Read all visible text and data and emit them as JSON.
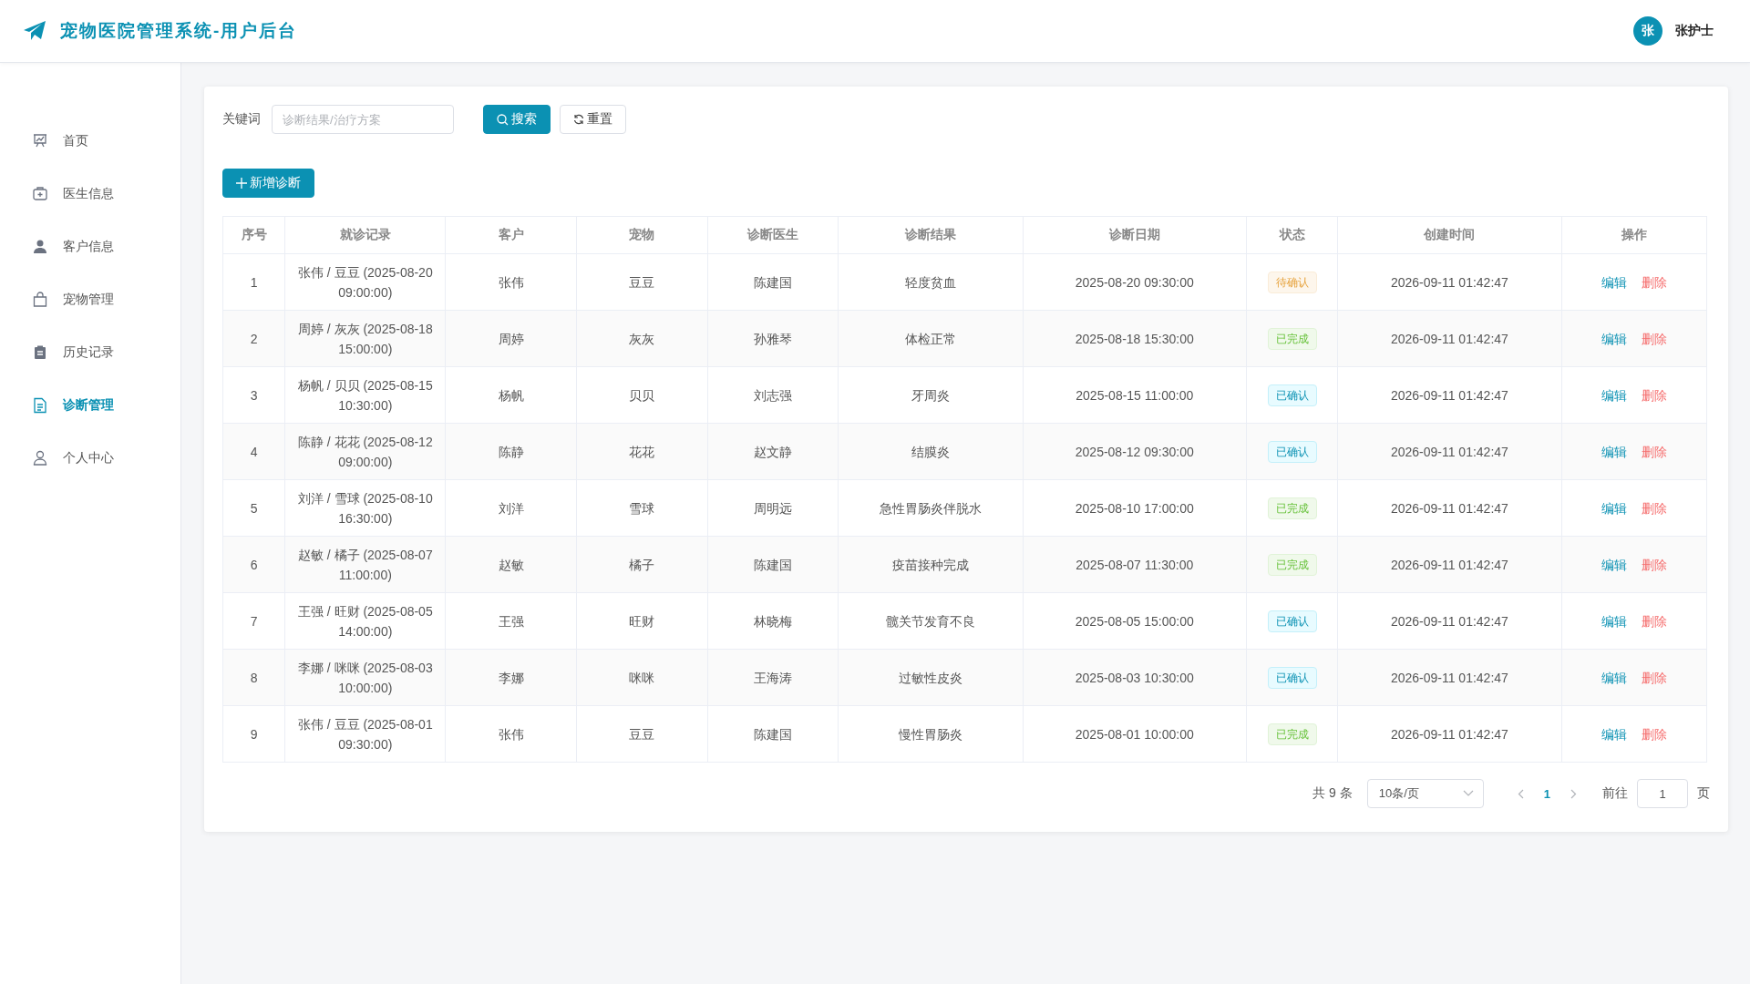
{
  "header": {
    "title": "宠物医院管理系统-用户后台",
    "user": {
      "avatar": "张",
      "name": "张护士"
    }
  },
  "sidebar": {
    "items": [
      {
        "label": "首页",
        "selected": false
      },
      {
        "label": "医生信息",
        "selected": false
      },
      {
        "label": "客户信息",
        "selected": false
      },
      {
        "label": "宠物管理",
        "selected": false
      },
      {
        "label": "历史记录",
        "selected": false
      },
      {
        "label": "诊断管理",
        "selected": true
      },
      {
        "label": "个人中心",
        "selected": false
      }
    ]
  },
  "search": {
    "label": "关键词",
    "placeholder": "诊断结果/治疗方案",
    "search_button": "搜索",
    "reset_button": "重置"
  },
  "add_button": "新增诊断",
  "table": {
    "columns": [
      "序号",
      "就诊记录",
      "客户",
      "宠物",
      "诊断医生",
      "诊断结果",
      "诊断日期",
      "状态",
      "创建时间",
      "操作"
    ],
    "rows": [
      {
        "index": "1",
        "record": "张伟 / 豆豆 (2025-08-20 09:00:00)",
        "customer": "张伟",
        "pet": "豆豆",
        "doctor": "陈建国",
        "result": "轻度贫血",
        "date": "2025-08-20 09:30:00",
        "status": {
          "label": "待确认",
          "kind": "pending"
        },
        "created": "2026-09-11 01:42:47",
        "actions": [
          "编辑",
          "删除"
        ]
      },
      {
        "index": "2",
        "record": "周婷 / 灰灰 (2025-08-18 15:00:00)",
        "customer": "周婷",
        "pet": "灰灰",
        "doctor": "孙雅琴",
        "result": "体检正常",
        "date": "2025-08-18 15:30:00",
        "status": {
          "label": "已完成",
          "kind": "done"
        },
        "created": "2026-09-11 01:42:47",
        "actions": [
          "编辑",
          "删除"
        ]
      },
      {
        "index": "3",
        "record": "杨帆 / 贝贝 (2025-08-15 10:30:00)",
        "customer": "杨帆",
        "pet": "贝贝",
        "doctor": "刘志强",
        "result": "牙周炎",
        "date": "2025-08-15 11:00:00",
        "status": {
          "label": "已确认",
          "kind": "confirmed"
        },
        "created": "2026-09-11 01:42:47",
        "actions": [
          "编辑",
          "删除"
        ]
      },
      {
        "index": "4",
        "record": "陈静 / 花花 (2025-08-12 09:00:00)",
        "customer": "陈静",
        "pet": "花花",
        "doctor": "赵文静",
        "result": "结膜炎",
        "date": "2025-08-12 09:30:00",
        "status": {
          "label": "已确认",
          "kind": "confirmed"
        },
        "created": "2026-09-11 01:42:47",
        "actions": [
          "编辑",
          "删除"
        ]
      },
      {
        "index": "5",
        "record": "刘洋 / 雪球 (2025-08-10 16:30:00)",
        "customer": "刘洋",
        "pet": "雪球",
        "doctor": "周明远",
        "result": "急性胃肠炎伴脱水",
        "date": "2025-08-10 17:00:00",
        "status": {
          "label": "已完成",
          "kind": "done"
        },
        "created": "2026-09-11 01:42:47",
        "actions": [
          "编辑",
          "删除"
        ]
      },
      {
        "index": "6",
        "record": "赵敏 / 橘子 (2025-08-07 11:00:00)",
        "customer": "赵敏",
        "pet": "橘子",
        "doctor": "陈建国",
        "result": "疫苗接种完成",
        "date": "2025-08-07 11:30:00",
        "status": {
          "label": "已完成",
          "kind": "done"
        },
        "created": "2026-09-11 01:42:47",
        "actions": [
          "编辑",
          "删除"
        ]
      },
      {
        "index": "7",
        "record": "王强 / 旺财 (2025-08-05 14:00:00)",
        "customer": "王强",
        "pet": "旺财",
        "doctor": "林晓梅",
        "result": "髋关节发育不良",
        "date": "2025-08-05 15:00:00",
        "status": {
          "label": "已确认",
          "kind": "confirmed"
        },
        "created": "2026-09-11 01:42:47",
        "actions": [
          "编辑",
          "删除"
        ]
      },
      {
        "index": "8",
        "record": "李娜 / 咪咪 (2025-08-03 10:00:00)",
        "customer": "李娜",
        "pet": "咪咪",
        "doctor": "王海涛",
        "result": "过敏性皮炎",
        "date": "2025-08-03 10:30:00",
        "status": {
          "label": "已确认",
          "kind": "confirmed"
        },
        "created": "2026-09-11 01:42:47",
        "actions": [
          "编辑",
          "删除"
        ]
      },
      {
        "index": "9",
        "record": "张伟 / 豆豆 (2025-08-01 09:30:00)",
        "customer": "张伟",
        "pet": "豆豆",
        "doctor": "陈建国",
        "result": "慢性胃肠炎",
        "date": "2025-08-01 10:00:00",
        "status": {
          "label": "已完成",
          "kind": "done"
        },
        "created": "2026-09-11 01:42:47",
        "actions": [
          "编辑",
          "删除"
        ]
      }
    ]
  },
  "pagination": {
    "total": "共 9 条",
    "page_size": "10条/页",
    "pages": [
      {
        "label": "1",
        "selected": true
      }
    ],
    "goto_label": "前往",
    "goto_value": "1",
    "goto_suffix": "页"
  }
}
